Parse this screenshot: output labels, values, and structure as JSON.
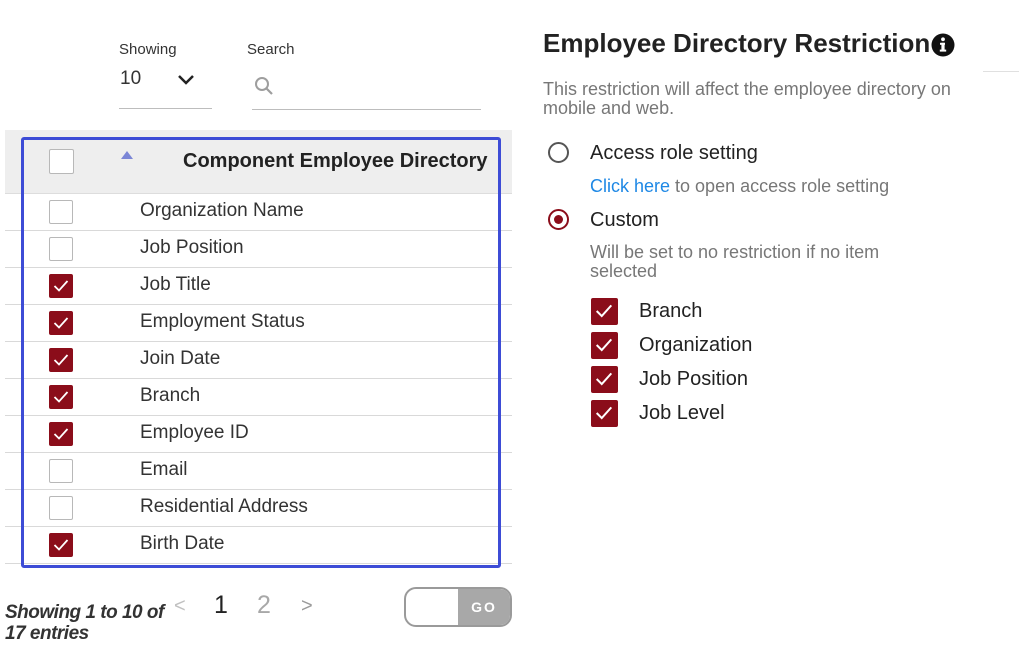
{
  "showing": {
    "label": "Showing",
    "value": "10"
  },
  "search": {
    "label": "Search",
    "placeholder": ""
  },
  "table": {
    "header": "Component Employee Directory",
    "rows": [
      {
        "label": "Organization Name",
        "checked": false
      },
      {
        "label": "Job Position",
        "checked": false
      },
      {
        "label": "Job Title",
        "checked": true
      },
      {
        "label": "Employment Status",
        "checked": true
      },
      {
        "label": "Join Date",
        "checked": true
      },
      {
        "label": "Branch",
        "checked": true
      },
      {
        "label": "Employee ID",
        "checked": true
      },
      {
        "label": "Email",
        "checked": false
      },
      {
        "label": "Residential Address",
        "checked": false
      },
      {
        "label": "Birth Date",
        "checked": true
      }
    ]
  },
  "pagination": {
    "entries_line1": "Showing 1 to 10 of",
    "entries_line2": "17 entries",
    "prev": "<",
    "pages": [
      "1",
      "2"
    ],
    "next": ">",
    "go": "GO"
  },
  "restriction": {
    "title": "Employee Directory Restriction",
    "description": "This restriction will affect the employee directory on mobile and web.",
    "access_role_label": "Access role setting",
    "click_here": "Click here",
    "access_hint": " to open access role setting",
    "custom_label": "Custom",
    "selected_option": "Custom",
    "custom_hint": "Will be set to no restriction if no item selected",
    "custom_items": [
      "Branch",
      "Organization",
      "Job Position",
      "Job Level"
    ]
  },
  "colors": {
    "accent": "#8b0d1a",
    "highlight_border": "#3d4cd6",
    "link": "#1e88e5"
  }
}
